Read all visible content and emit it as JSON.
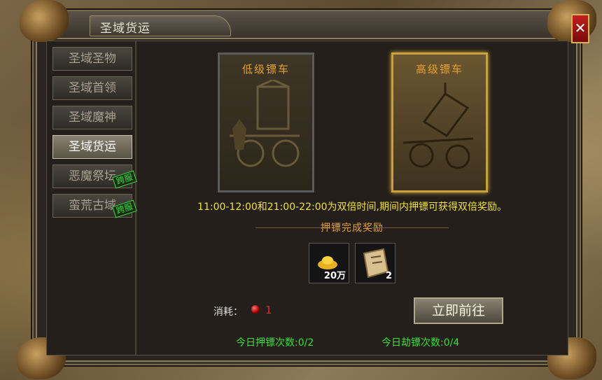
{
  "window": {
    "title": "圣域货运",
    "close_symbol": "✕"
  },
  "sidebar": {
    "tabs": [
      {
        "label": "圣域圣物",
        "badge": ""
      },
      {
        "label": "圣域首领",
        "badge": ""
      },
      {
        "label": "圣域魔神",
        "badge": ""
      },
      {
        "label": "圣域货运",
        "badge": "",
        "active": true
      },
      {
        "label": "恶魔祭坛",
        "badge": "跨服"
      },
      {
        "label": "蛮荒古域",
        "badge": "跨服"
      }
    ]
  },
  "escort": {
    "low_card_title": "低级镖车",
    "high_card_title": "高级镖车",
    "selected": "high",
    "double_time_text": "11:00-12:00和21:00-22:00为双倍时间,期间内押镖可获得双倍奖励。",
    "reward_title": "押镖完成奖励",
    "rewards": [
      {
        "icon": "gold-ingot-icon",
        "count": "20万"
      },
      {
        "icon": "scroll-icon",
        "count": "2"
      }
    ],
    "cost_label": "消耗：",
    "cost_icon": "red-orb-icon",
    "cost_value": "1",
    "go_button": "立即前往",
    "escort_count": "今日押镖次数:0/2",
    "rob_count": "今日劫镖次数:0/4"
  },
  "colors": {
    "accent_gold": "#e8a030",
    "highlight_yellow": "#f0e040",
    "count_green": "#3adf3a",
    "cost_red": "#d03030"
  }
}
